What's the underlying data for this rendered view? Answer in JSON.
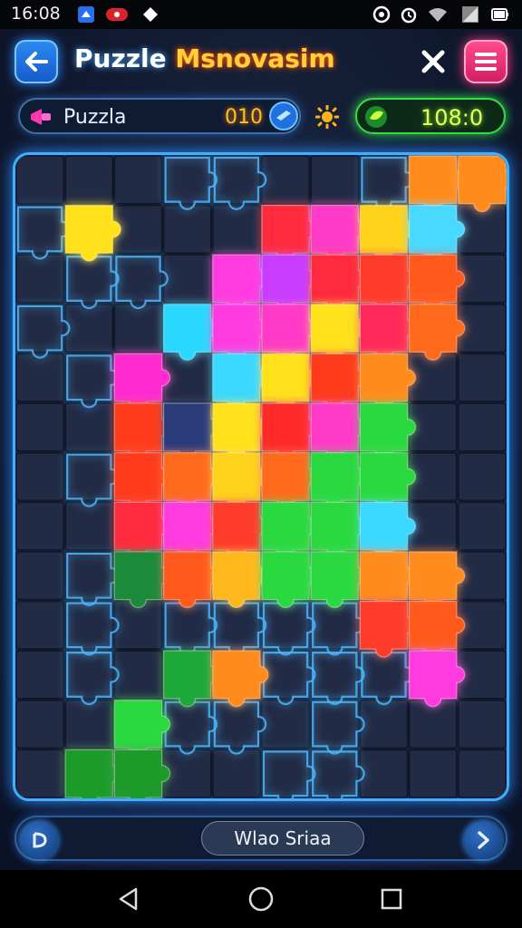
{
  "status_bar": {
    "time": "16:08",
    "left_icons": [
      "notification-app-icon",
      "notification-record-icon",
      "notification-shape-icon"
    ],
    "right_icons": [
      "do-not-disturb-icon",
      "alarm-icon",
      "wifi-icon",
      "signal-icon",
      "battery-icon"
    ]
  },
  "header": {
    "title_part1": "Puzzle",
    "title_part2": "Msnovasim",
    "back_icon": "arrow-left-icon",
    "close_icon": "close-icon",
    "menu_icon": "hamburger-menu-icon"
  },
  "stats": {
    "mode_label": "Puzzla",
    "score": "010",
    "level_value": "108:0"
  },
  "board": {
    "columns": 10,
    "rows": 13,
    "empty_color": "#222b45",
    "grid_line_color": "#0f1526",
    "outline_color": "#4fb8ff",
    "tiles": [
      {
        "col": 1,
        "row": 1,
        "color": "#ffe11a"
      },
      {
        "col": 8,
        "row": 0,
        "color": "#ff8c1a"
      },
      {
        "col": 9,
        "row": 0,
        "color": "#ff8c1a"
      },
      {
        "col": 5,
        "row": 1,
        "color": "#ff2a3c"
      },
      {
        "col": 6,
        "row": 1,
        "color": "#ff3ac8"
      },
      {
        "col": 7,
        "row": 1,
        "color": "#ffd21a"
      },
      {
        "col": 8,
        "row": 1,
        "color": "#4ad8ff"
      },
      {
        "col": 4,
        "row": 2,
        "color": "#ff3ae0"
      },
      {
        "col": 5,
        "row": 2,
        "color": "#c83aff"
      },
      {
        "col": 6,
        "row": 2,
        "color": "#ff2a3c"
      },
      {
        "col": 7,
        "row": 2,
        "color": "#ff3a2a"
      },
      {
        "col": 8,
        "row": 2,
        "color": "#ff5a1a"
      },
      {
        "col": 3,
        "row": 3,
        "color": "#2ad8ff"
      },
      {
        "col": 4,
        "row": 3,
        "color": "#ff3ae0"
      },
      {
        "col": 5,
        "row": 3,
        "color": "#ff3ac8"
      },
      {
        "col": 6,
        "row": 3,
        "color": "#ffe11a"
      },
      {
        "col": 7,
        "row": 3,
        "color": "#ff2a5a"
      },
      {
        "col": 8,
        "row": 3,
        "color": "#ff6a1a"
      },
      {
        "col": 2,
        "row": 4,
        "color": "#ff2ad0"
      },
      {
        "col": 4,
        "row": 4,
        "color": "#3ad8ff"
      },
      {
        "col": 5,
        "row": 4,
        "color": "#ffe11a"
      },
      {
        "col": 6,
        "row": 4,
        "color": "#ff3a1a"
      },
      {
        "col": 7,
        "row": 4,
        "color": "#ff8c1a"
      },
      {
        "col": 2,
        "row": 5,
        "color": "#ff3a1a"
      },
      {
        "col": 3,
        "row": 5,
        "color": "#2a3a7a"
      },
      {
        "col": 4,
        "row": 5,
        "color": "#ffe11a"
      },
      {
        "col": 5,
        "row": 5,
        "color": "#ff2a2a"
      },
      {
        "col": 6,
        "row": 5,
        "color": "#ff3ac8"
      },
      {
        "col": 7,
        "row": 5,
        "color": "#2ad840"
      },
      {
        "col": 2,
        "row": 6,
        "color": "#ff3a1a"
      },
      {
        "col": 3,
        "row": 6,
        "color": "#ff6a1a"
      },
      {
        "col": 4,
        "row": 6,
        "color": "#ffd21a"
      },
      {
        "col": 5,
        "row": 6,
        "color": "#ff6a1a"
      },
      {
        "col": 6,
        "row": 6,
        "color": "#2ad840"
      },
      {
        "col": 7,
        "row": 6,
        "color": "#2ad840"
      },
      {
        "col": 2,
        "row": 7,
        "color": "#ff2a3c"
      },
      {
        "col": 3,
        "row": 7,
        "color": "#ff3ae0"
      },
      {
        "col": 4,
        "row": 7,
        "color": "#ff3a2a"
      },
      {
        "col": 5,
        "row": 7,
        "color": "#2ad840"
      },
      {
        "col": 6,
        "row": 7,
        "color": "#2ad840"
      },
      {
        "col": 7,
        "row": 7,
        "color": "#3ad8ff"
      },
      {
        "col": 2,
        "row": 8,
        "color": "#1a8a3a"
      },
      {
        "col": 3,
        "row": 8,
        "color": "#ff5a1a"
      },
      {
        "col": 4,
        "row": 8,
        "color": "#ffb81a"
      },
      {
        "col": 5,
        "row": 8,
        "color": "#2ad840"
      },
      {
        "col": 6,
        "row": 8,
        "color": "#2ad840"
      },
      {
        "col": 7,
        "row": 8,
        "color": "#ff8c1a"
      },
      {
        "col": 8,
        "row": 8,
        "color": "#ff8c1a"
      },
      {
        "col": 7,
        "row": 9,
        "color": "#ff3a2a"
      },
      {
        "col": 8,
        "row": 9,
        "color": "#ff5a1a"
      },
      {
        "col": 3,
        "row": 10,
        "color": "#1aa83a"
      },
      {
        "col": 4,
        "row": 10,
        "color": "#ff8c1a"
      },
      {
        "col": 8,
        "row": 10,
        "color": "#ff3ae0"
      },
      {
        "col": 2,
        "row": 11,
        "color": "#2ad840"
      },
      {
        "col": 1,
        "row": 12,
        "color": "#1a9a2a"
      },
      {
        "col": 2,
        "row": 12,
        "color": "#1a9a2a"
      }
    ],
    "outlined": [
      {
        "col": 3,
        "row": 0
      },
      {
        "col": 4,
        "row": 0
      },
      {
        "col": 7,
        "row": 0
      },
      {
        "col": 0,
        "row": 1
      },
      {
        "col": 1,
        "row": 2
      },
      {
        "col": 2,
        "row": 2
      },
      {
        "col": 0,
        "row": 3
      },
      {
        "col": 1,
        "row": 4
      },
      {
        "col": 1,
        "row": 6
      },
      {
        "col": 1,
        "row": 8
      },
      {
        "col": 1,
        "row": 9
      },
      {
        "col": 3,
        "row": 9
      },
      {
        "col": 4,
        "row": 9
      },
      {
        "col": 5,
        "row": 9
      },
      {
        "col": 6,
        "row": 9
      },
      {
        "col": 1,
        "row": 10
      },
      {
        "col": 5,
        "row": 10
      },
      {
        "col": 6,
        "row": 10
      },
      {
        "col": 7,
        "row": 10
      },
      {
        "col": 3,
        "row": 11
      },
      {
        "col": 4,
        "row": 11
      },
      {
        "col": 6,
        "row": 11
      },
      {
        "col": 5,
        "row": 12
      },
      {
        "col": 6,
        "row": 12
      }
    ]
  },
  "footer": {
    "left_icon": "rotate-icon",
    "hint_label": "Wlao Sriaa",
    "right_icon": "chevron-right-icon"
  },
  "nav_bar": {
    "back_icon": "nav-back-icon",
    "home_icon": "nav-home-icon",
    "recents_icon": "nav-recents-icon"
  }
}
